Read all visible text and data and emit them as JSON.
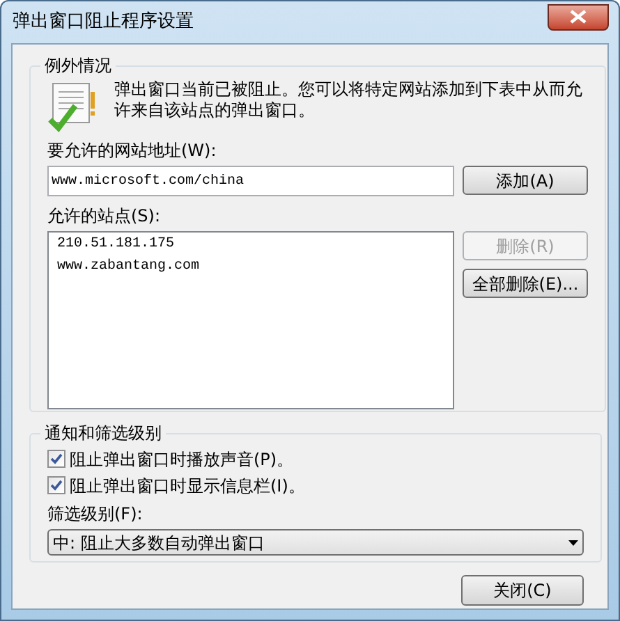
{
  "window": {
    "title": "弹出窗口阻止程序设置"
  },
  "exceptions": {
    "heading": "例外情况",
    "message": "弹出窗口当前已被阻止。您可以将特定网站添加到下表中从而允许来自该站点的弹出窗口。",
    "address_label": "要允许的网站地址(W):",
    "address_value": "www.microsoft.com/china",
    "add_button": "添加(A)",
    "sites_label": "允许的站点(S):",
    "sites": [
      {
        "text": "210.51.181.175",
        "selected": false
      },
      {
        "text": "www.zabantang.com",
        "selected": false
      }
    ],
    "buttons": [
      {
        "label": "删除(R)",
        "disabled": true
      },
      {
        "label": "全部删除(E)...",
        "disabled": false
      }
    ]
  },
  "notifications": {
    "heading": "通知和筛选级别",
    "options": [
      {
        "label": "阻止弹出窗口时播放声音(P)。",
        "checked": true
      },
      {
        "label": "阻止弹出窗口时显示信息栏(I)。",
        "checked": true
      }
    ],
    "level_label": "筛选级别(F):",
    "level_value": "中: 阻止大多数自动弹出窗口"
  },
  "close_button": "关闭(C)"
}
